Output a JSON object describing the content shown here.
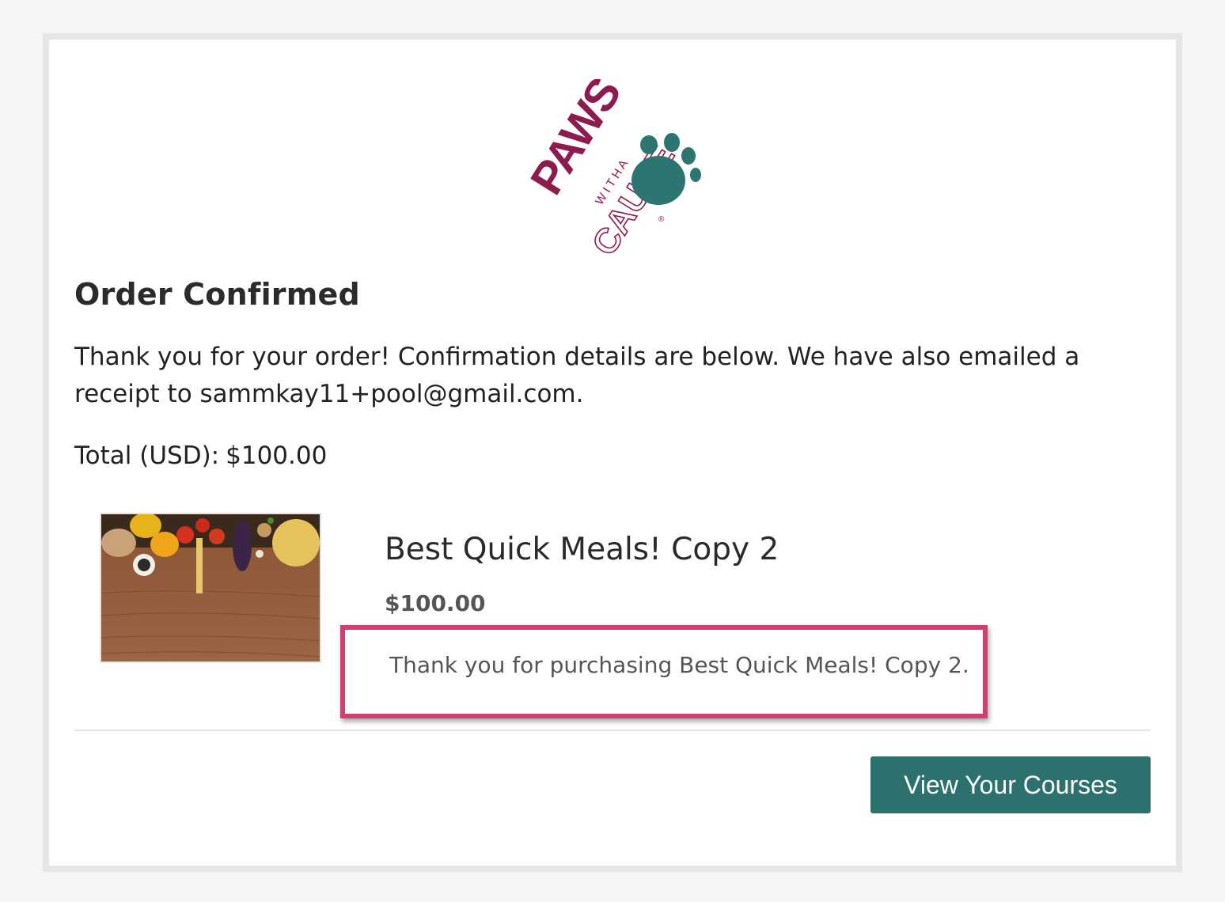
{
  "logo": {
    "word": "PAWS",
    "with": "W I T H A",
    "cause": "CAUSE",
    "reg": "®",
    "colors": {
      "primary": "#8e1b4e",
      "paw": "#2d7571"
    }
  },
  "order": {
    "title": "Order Confirmed",
    "intro": "Thank you for your order! Confirmation details are below. We have also emailed a receipt to sammkay11+pool@gmail.com.",
    "total_label": "Total (USD):",
    "total_value": "$100.00"
  },
  "product": {
    "name": "Best Quick Meals! Copy 2",
    "price": "$100.00",
    "message": "Thank you for purchasing Best Quick Meals! Copy 2."
  },
  "actions": {
    "view_courses": "View Your Courses"
  },
  "colors": {
    "accent": "#2d716e",
    "highlight": "#cf3f74",
    "page_bg": "#f5f5f5",
    "card_border": "#e6e6e6"
  }
}
